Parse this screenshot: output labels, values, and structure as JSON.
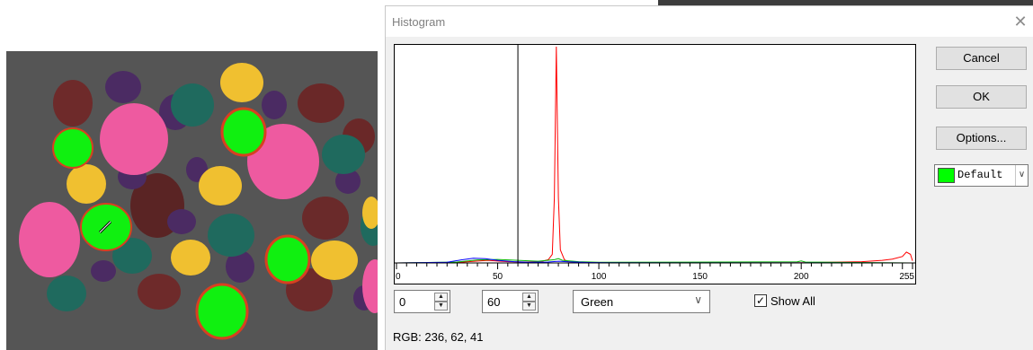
{
  "dialog": {
    "title": "Histogram",
    "close_glyph": "✕",
    "buttons": {
      "cancel": "Cancel",
      "ok": "OK",
      "options": "Options..."
    },
    "color_select": {
      "swatch_color": "#00ff00",
      "label": "Default"
    },
    "range_low": "0",
    "range_high": "60",
    "channel": "Green",
    "show_all": {
      "checked": true,
      "label": "Show All"
    },
    "rgb_readout": "RGB: 236, 62, 41"
  },
  "chart_data": {
    "type": "line",
    "x_ticks": [
      "0",
      "50",
      "100",
      "150",
      "200",
      "255"
    ],
    "xlim": [
      0,
      255
    ],
    "threshold_marker": 60,
    "series": [
      {
        "color": "#ff0000",
        "x": [
          0,
          30,
          45,
          55,
          65,
          72,
          75,
          77,
          78,
          79,
          80,
          81,
          83,
          85,
          90,
          100,
          150,
          200,
          230,
          240,
          245,
          250,
          252,
          254,
          255
        ],
        "y": [
          0,
          0.2,
          1.2,
          0.6,
          0.4,
          0.8,
          1.5,
          4,
          30,
          100,
          30,
          6,
          1.5,
          0.6,
          0.3,
          0.1,
          0.05,
          0.1,
          0.6,
          1.2,
          1.8,
          3,
          5,
          4,
          1
        ]
      },
      {
        "color": "#00b000",
        "x": [
          0,
          30,
          40,
          50,
          60,
          70,
          78,
          80,
          82,
          90,
          100,
          198,
          200,
          202,
          255
        ],
        "y": [
          0,
          0.4,
          1.4,
          1.6,
          1.2,
          0.8,
          1.5,
          2,
          1.2,
          0.6,
          0.3,
          0.5,
          0.9,
          0.4,
          0
        ]
      },
      {
        "color": "#0000ff",
        "x": [
          0,
          25,
          32,
          38,
          44,
          50,
          58,
          65,
          75,
          80,
          85,
          95,
          105,
          255
        ],
        "y": [
          0,
          0.3,
          1.4,
          2.2,
          2.0,
          1.2,
          0.6,
          0.3,
          0.4,
          0.8,
          0.5,
          0.2,
          0.1,
          0
        ]
      }
    ]
  }
}
